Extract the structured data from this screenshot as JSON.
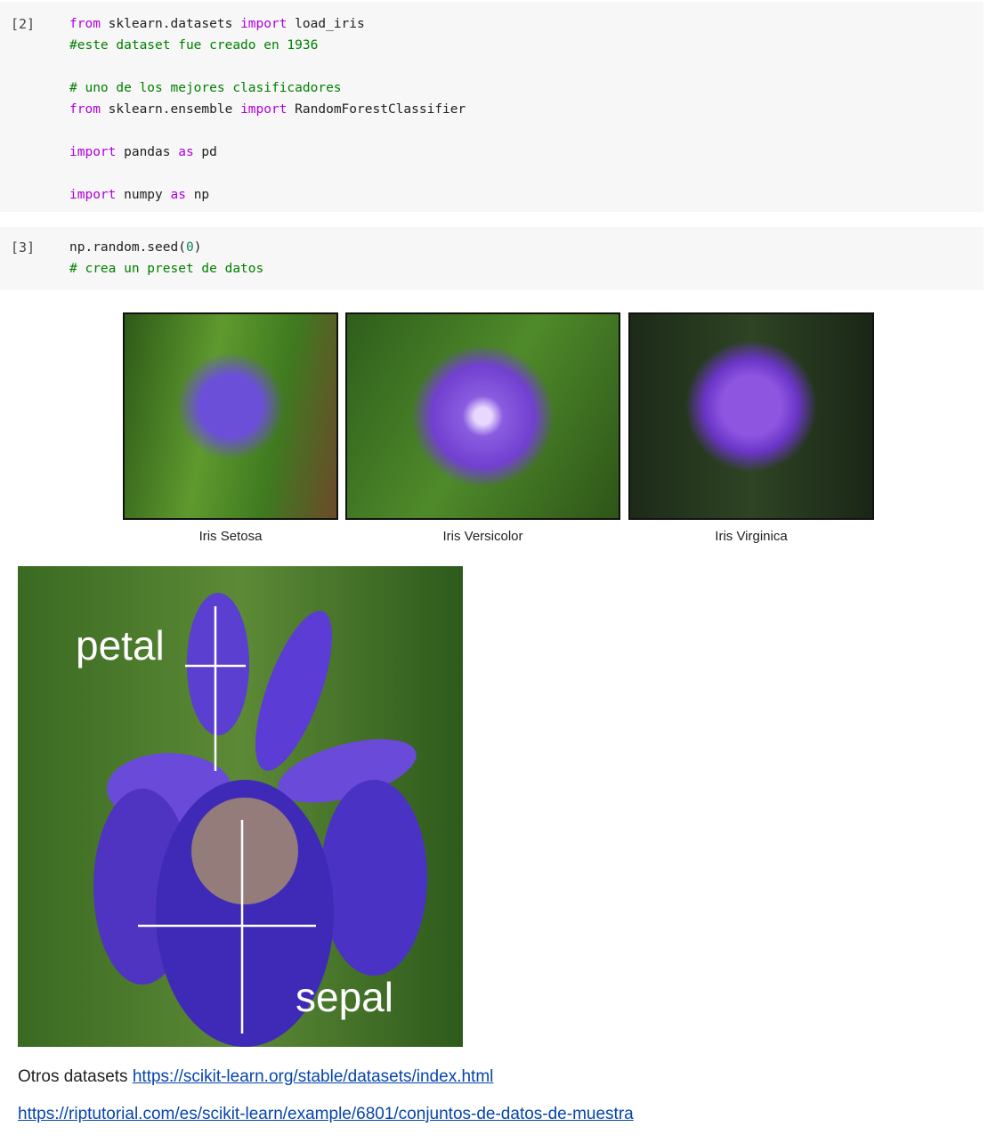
{
  "cells": [
    {
      "prompt": "[2]",
      "lines": [
        [
          {
            "t": "from",
            "c": "kw"
          },
          {
            "t": " sklearn.datasets "
          },
          {
            "t": "import",
            "c": "kw"
          },
          {
            "t": " load_iris"
          }
        ],
        [
          {
            "t": "#este dataset fue creado en 1936",
            "c": "cm"
          }
        ],
        [],
        [
          {
            "t": "# uno de los mejores clasificadores",
            "c": "cm"
          }
        ],
        [
          {
            "t": "from",
            "c": "kw"
          },
          {
            "t": " sklearn.ensemble "
          },
          {
            "t": "import",
            "c": "kw"
          },
          {
            "t": " RandomForestClassifier"
          }
        ],
        [],
        [
          {
            "t": "import",
            "c": "kw"
          },
          {
            "t": " pandas "
          },
          {
            "t": "as",
            "c": "kw"
          },
          {
            "t": " pd"
          }
        ],
        [],
        [
          {
            "t": "import",
            "c": "kw"
          },
          {
            "t": " numpy "
          },
          {
            "t": "as",
            "c": "kw"
          },
          {
            "t": " np"
          }
        ]
      ]
    },
    {
      "prompt": "[3]",
      "lines": [
        [
          {
            "t": "np.random.seed("
          },
          {
            "t": "0",
            "c": "num"
          },
          {
            "t": ")"
          }
        ],
        [
          {
            "t": "# crea un preset de datos",
            "c": "cm"
          }
        ]
      ]
    }
  ],
  "species": [
    {
      "caption": "Iris Setosa"
    },
    {
      "caption": "Iris Versicolor"
    },
    {
      "caption": "Iris Virginica"
    }
  ],
  "diagram": {
    "petal_label": "petal",
    "sepal_label": "sepal"
  },
  "links": {
    "prefix": "Otros datasets ",
    "link1": "https://scikit-learn.org/stable/datasets/index.html",
    "link2": "https://riptutorial.com/es/scikit-learn/example/6801/conjuntos-de-datos-de-muestra"
  },
  "colors": {
    "keyword": "#af00db",
    "comment": "#008000",
    "number": "#098658",
    "flower": "#6a3fd0"
  }
}
